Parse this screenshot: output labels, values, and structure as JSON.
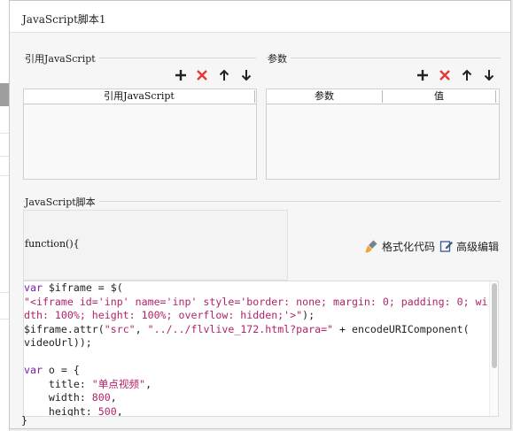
{
  "window": {
    "title": "JavaScript脚本1"
  },
  "ref_group": {
    "label": "引用JavaScript",
    "columns": [
      "引用JavaScript"
    ]
  },
  "param_group": {
    "label": "参数",
    "columns": [
      "参数",
      "值"
    ]
  },
  "toolbar_icons": [
    "add-icon",
    "delete-icon",
    "arrow-up-icon",
    "arrow-down-icon"
  ],
  "script_group": {
    "label": "JavaScript脚本",
    "function_header": "function(){",
    "format_label": "格式化代码",
    "advanced_label": "高级编辑",
    "closing": "}"
  },
  "code_lines": [
    [
      {
        "t": "var",
        "c": "kw"
      },
      {
        "t": " $iframe = $(",
        "c": "pl"
      }
    ],
    [
      {
        "t": "\"<iframe id='inp' name='inp' style='border: none; margin: 0; padding: 0; wi",
        "c": "str"
      }
    ],
    [
      {
        "t": "dth: 100%; height: 100%; overflow: hidden;'>\"",
        "c": "str"
      },
      {
        "t": ");",
        "c": "pl"
      }
    ],
    [
      {
        "t": "$iframe.attr(",
        "c": "pl"
      },
      {
        "t": "\"src\"",
        "c": "str"
      },
      {
        "t": ", ",
        "c": "pl"
      },
      {
        "t": "\"../../flvlive_172.html?para=\"",
        "c": "str"
      },
      {
        "t": " + encodeURIComponent(",
        "c": "pl"
      }
    ],
    [
      {
        "t": "videoUrl));",
        "c": "pl"
      }
    ],
    [
      {
        "t": "",
        "c": "pl"
      }
    ],
    [
      {
        "t": "var",
        "c": "kw"
      },
      {
        "t": " o = {",
        "c": "pl"
      }
    ],
    [
      {
        "t": "    title: ",
        "c": "pl"
      },
      {
        "t": "\"单点视频\"",
        "c": "str"
      },
      {
        "t": ",",
        "c": "pl"
      }
    ],
    [
      {
        "t": "    width: ",
        "c": "pl"
      },
      {
        "t": "800",
        "c": "num"
      },
      {
        "t": ",",
        "c": "pl"
      }
    ],
    [
      {
        "t": "    height: ",
        "c": "pl"
      },
      {
        "t": "500",
        "c": "num"
      },
      {
        "t": ",",
        "c": "pl"
      }
    ]
  ],
  "colors": {
    "add": "#222222",
    "delete": "#e53935",
    "arrow": "#222222",
    "keyword": "#7a1fa8",
    "string": "#b2226b",
    "brush": "#f2a33a"
  }
}
